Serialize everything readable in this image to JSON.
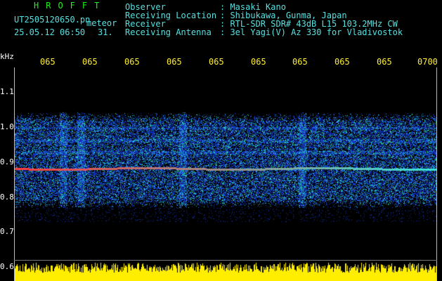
{
  "app_title": "HROFFT",
  "file": {
    "name": "UT2505120650.pn",
    "type_label": "meteor",
    "datetime": "25.05.12 06:50",
    "count": "31."
  },
  "metadata": [
    {
      "label": "Observer",
      "value": ": Masaki Kano"
    },
    {
      "label": "Receiving Location",
      "value": ": Shibukawa, Gunma, Japan"
    },
    {
      "label": "Receiver",
      "value": ": RTL-SDR SDR# 43dB L15 103.2MHz CW"
    },
    {
      "label": "Receiving Antenna",
      "value": ": 3el Yagi(V) Az 330 for Vladivostok"
    }
  ],
  "y_axis": {
    "unit": "kHz",
    "ticks": [
      "1.1",
      "1.0",
      "0.9",
      "0.8",
      "0.7",
      "0.6"
    ]
  },
  "x_axis": {
    "ticks": [
      "065",
      "065",
      "065",
      "065",
      "065",
      "065",
      "065",
      "065",
      "065",
      "0700"
    ]
  },
  "colors": {
    "background": "#000000",
    "title_green": "#22ee22",
    "header_cyan": "#58e0e0",
    "tick_yellow": "#ffee33",
    "signal_red": "#ff3030",
    "noise_blue": "#1a3cb4"
  }
}
